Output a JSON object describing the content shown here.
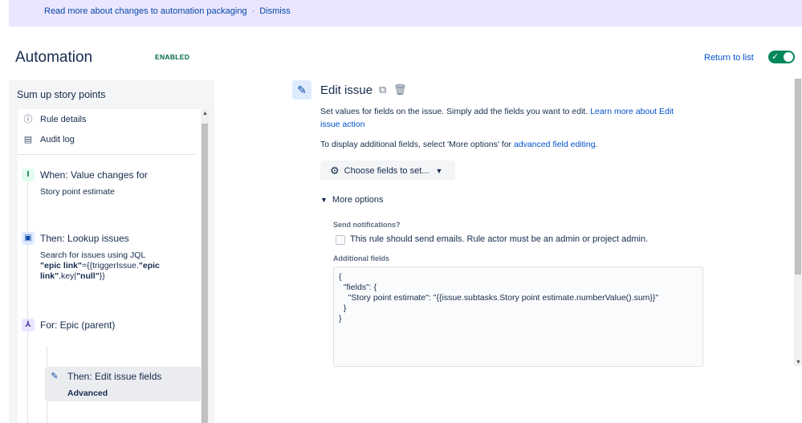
{
  "banner": {
    "link_text": "Read more about changes to automation packaging",
    "separator": "·",
    "dismiss": "Dismiss"
  },
  "header": {
    "title": "Automation",
    "status": "ENABLED",
    "return_link": "Return to list",
    "toggle_on": true
  },
  "sidebar": {
    "rule_name": "Sum up story points",
    "nav": [
      {
        "label": "Rule details",
        "icon": "info-icon"
      },
      {
        "label": "Audit log",
        "icon": "document-icon"
      }
    ],
    "steps": {
      "trigger": {
        "title": "When: Value changes for",
        "subtitle": "Story point estimate",
        "icon": "trigger-icon"
      },
      "lookup": {
        "title": "Then: Lookup issues",
        "subtitle_prefix": "Search for issues using JQL",
        "jql_bold1": "\"epic link\"",
        "jql_normal1": "={{triggerIssue.",
        "jql_bold2": "\"epic",
        "jql_line2_bold": "link\"",
        "jql_line2_normal": ".key|",
        "jql_line2_bold2": "\"null\"",
        "jql_line2_end": "}}",
        "icon": "lookup-icon"
      },
      "branch": {
        "title": "For: Epic (parent)",
        "icon": "branch-icon"
      },
      "edit": {
        "title": "Then: Edit issue fields",
        "subtitle": "Advanced",
        "icon": "pencil-icon"
      }
    }
  },
  "main": {
    "title": "Edit issue",
    "description": "Set values for fields on the issue. Simply add the fields you want to edit.",
    "learn_more": "Learn more about Edit",
    "learn_more_2": "issue action",
    "display_prefix": "To display additional fields, select 'More options' for",
    "display_link": "advanced field editing",
    "display_suffix": ".",
    "choose_button": "Choose fields to set...",
    "more_options": "More options",
    "send_notifications_label": "Send notifications?",
    "send_notifications_text": "This rule should send emails. Rule actor must be an admin or project admin.",
    "send_notifications_checked": false,
    "additional_fields_label": "Additional fields",
    "additional_fields_value": "{\n  \"fields\": {\n    \"Story point estimate\": \"{{issue.subtasks.Story point estimate.numberValue().sum}}\"\n  }\n}"
  },
  "colors": {
    "banner_bg": "#eae6ff",
    "link": "#0052cc",
    "toggle_on": "#00875a",
    "enabled_text": "#006644"
  }
}
